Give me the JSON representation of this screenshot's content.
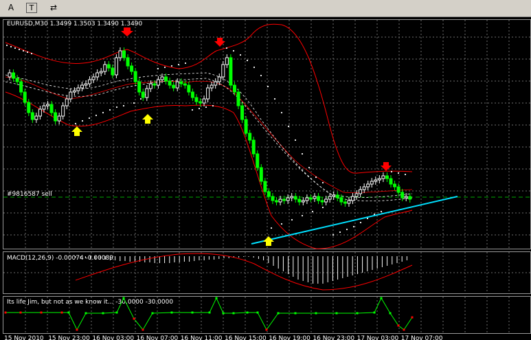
{
  "toolbar": {
    "text_tool": "A",
    "label_tool": "T",
    "arrows_tool": "⇄"
  },
  "main_chart": {
    "title": "EURUSD,M30  1.3499 1.3503 1.3490 1.3490",
    "order_label": "#9816587 sell"
  },
  "macd_panel": {
    "title": "MACD(12,26,9) -0.00074 -0.00089"
  },
  "indicator_panel": {
    "title": "Its life Jim, but not as we know it...  -30.0000  -30.0000"
  },
  "time_axis": {
    "labels": [
      "15 Nov 2010",
      "15 Nov 23:00",
      "16 Nov 03:00",
      "16 Nov 07:00",
      "16 Nov 11:00",
      "16 Nov 15:00",
      "16 Nov 19:00",
      "16 Nov 23:00",
      "17 Nov 03:00",
      "17 Nov 07:00"
    ]
  },
  "colors": {
    "bull_candle": "#ffffff",
    "bear_candle": "#00ff00",
    "band": "#ff0000",
    "trendline": "#00e0ff",
    "grid": "#777777",
    "buy_arrow": "#ffff00",
    "sell_arrow": "#ff0000"
  },
  "icons": [
    "text-tool-icon",
    "label-tool-icon",
    "arrows-tool-icon",
    "buy-arrow-icon",
    "sell-arrow-icon"
  ]
}
